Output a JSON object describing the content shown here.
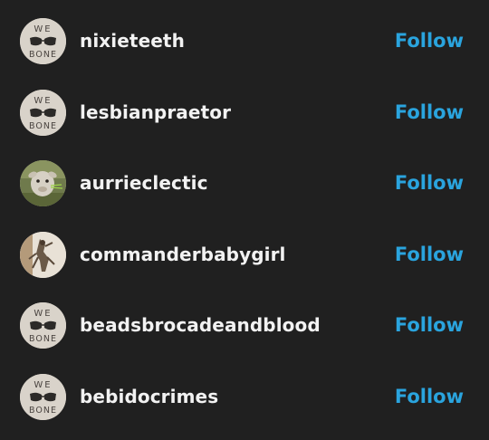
{
  "follow_label": "Follow",
  "avatar_text": {
    "top": "WE",
    "bottom": "BONE"
  },
  "users": [
    {
      "username": "nixieteeth",
      "avatar": "we-bone-logo"
    },
    {
      "username": "lesbianpraetor",
      "avatar": "we-bone-logo"
    },
    {
      "username": "aurrieclectic",
      "avatar": "goat-photo"
    },
    {
      "username": "commanderbabygirl",
      "avatar": "creature-photo"
    },
    {
      "username": "beadsbrocadeandblood",
      "avatar": "we-bone-logo"
    },
    {
      "username": "bebidocrimes",
      "avatar": "we-bone-logo"
    }
  ],
  "colors": {
    "background": "#202020",
    "username": "#f2f2f2",
    "follow": "#2aa4de"
  }
}
